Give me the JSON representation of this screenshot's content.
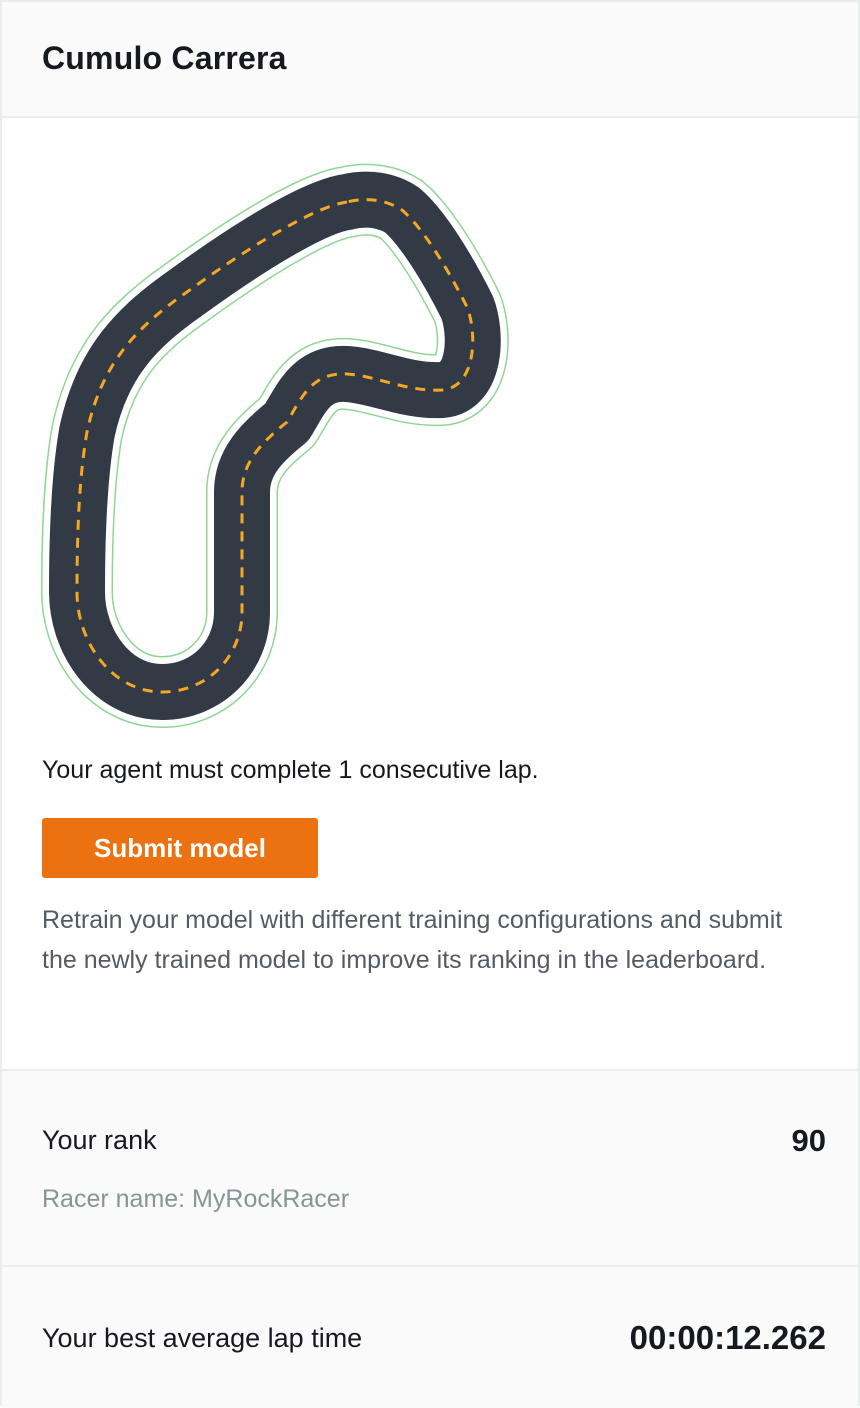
{
  "header": {
    "title": "Cumulo Carrera"
  },
  "requirement": {
    "text": "Your agent must complete 1 consecutive lap."
  },
  "actions": {
    "submit_label": "Submit model"
  },
  "description": {
    "text": "Retrain your model with different training configurations and submit the newly trained model to improve its ranking in the leaderboard."
  },
  "rank": {
    "label": "Your rank",
    "value": "90",
    "racer_name": "Racer name: MyRockRacer"
  },
  "lap_time": {
    "label": "Your best average lap time",
    "value": "00:00:12.262"
  },
  "colors": {
    "accent": "#ec7211",
    "track_asphalt": "#323a45",
    "track_center_line": "#f5a623",
    "track_outline": "#8fd694"
  }
}
